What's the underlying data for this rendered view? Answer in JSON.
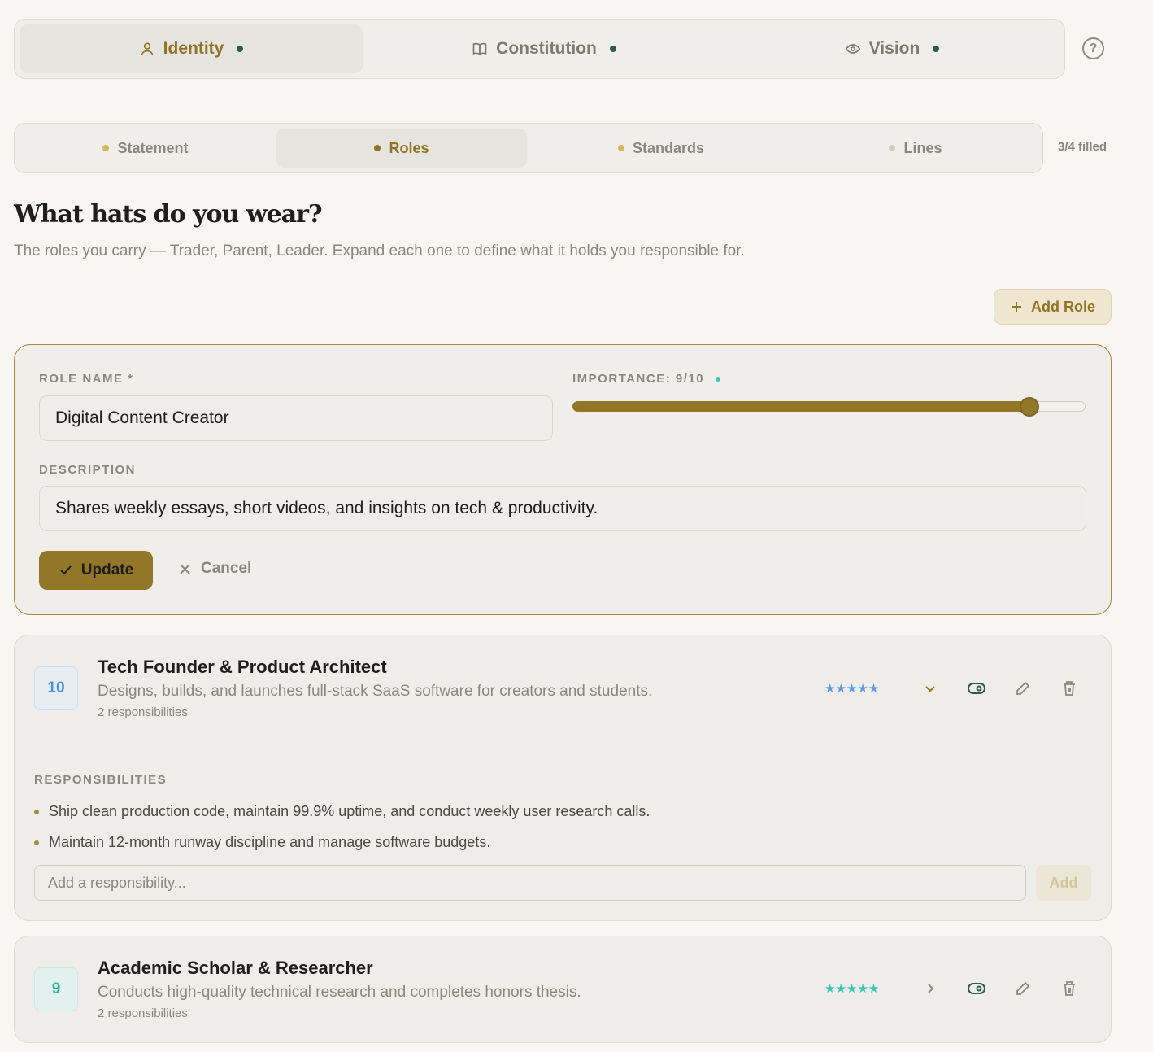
{
  "top_tabs": [
    {
      "label": "Identity",
      "icon": "user-icon"
    },
    {
      "label": "Constitution",
      "icon": "book-icon"
    },
    {
      "label": "Vision",
      "icon": "eye-icon"
    }
  ],
  "help_label": "?",
  "sub_tabs": [
    {
      "label": "Statement",
      "dot_color": "#d9b65d"
    },
    {
      "label": "Roles",
      "dot_color": "#8f7426"
    },
    {
      "label": "Standards",
      "dot_color": "#d9b65d"
    },
    {
      "label": "Lines",
      "dot_color": "#cfcbc3"
    }
  ],
  "filled_count": "3/4 filled",
  "heading": "What hats do you wear?",
  "subheading": "The roles you carry — Trader, Parent, Leader. Expand each one to define what it holds you responsible for.",
  "add_role_label": "Add Role",
  "edit_form": {
    "role_name_label": "ROLE NAME *",
    "role_name_value": "Digital Content Creator",
    "importance_label": "IMPORTANCE: 9/10",
    "importance_level": 0.89,
    "description_label": "DESCRIPTION",
    "description_value": "Shares weekly essays, short videos, and insights on tech & productivity.",
    "update_label": "Update",
    "cancel_label": "Cancel"
  },
  "roles": [
    {
      "badge": "10",
      "title": "Tech Founder & Product Architect",
      "description": "Designs, builds, and launches full-stack SaaS software for creators and students.",
      "responsibilities_count": "2 responsibilities",
      "stars": "★★★★★",
      "star_color": "#5b9ce8",
      "expanded": true,
      "responsibilities_heading": "RESPONSIBILITIES",
      "responsibilities": [
        "Ship clean production code, maintain 99.9% uptime, and conduct weekly user research calls.",
        "Maintain 12-month runway discipline and manage software budgets."
      ],
      "add_placeholder": "Add a responsibility...",
      "add_button": "Add"
    },
    {
      "badge": "9",
      "title": "Academic Scholar & Researcher",
      "description": "Conducts high-quality technical research and completes honors thesis.",
      "responsibilities_count": "2 responsibilities",
      "stars": "★★★★★",
      "star_color": "#35c7b8",
      "expanded": false
    }
  ],
  "colors": {
    "accent": "#937729",
    "active_tab_text": "#8f7426",
    "importance_dot": "#35c7b8",
    "status_dot": "#2e5a48"
  }
}
